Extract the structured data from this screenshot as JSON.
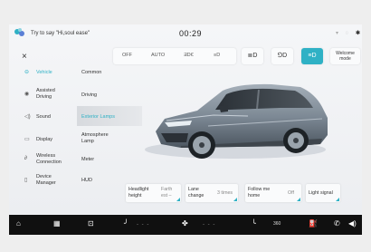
{
  "statusbar": {
    "assistant_hint": "Try to say \"Hi,soul ease\"",
    "time": "00:29",
    "wifi_icon": "wifi-icon",
    "signal_icon": "signal-icon",
    "bluetooth_icon": "bluetooth-icon"
  },
  "toolbar": {
    "close": "×",
    "light_modes": [
      "OFF",
      "AUTO",
      "ƎD€",
      "≡D"
    ],
    "extra_controls": [
      "≣D",
      "⅁D",
      "≡D"
    ],
    "active_control_index": 2,
    "welcome_line1": "Welcome",
    "welcome_line2": "mode"
  },
  "sidebar": {
    "items": [
      {
        "label": "Vehicle",
        "icon": "car-icon",
        "active": true
      },
      {
        "label1": "Assisted",
        "label2": "Driving",
        "icon": "steering-wheel-icon"
      },
      {
        "label": "Sound",
        "icon": "speaker-icon"
      },
      {
        "label": "Display",
        "icon": "monitor-icon"
      },
      {
        "label1": "Wireless",
        "label2": "Connection",
        "icon": "link-icon"
      },
      {
        "label1": "Device",
        "label2": "Manager",
        "icon": "phone-icon"
      }
    ]
  },
  "submenu": {
    "items": [
      {
        "label": "Common"
      },
      {
        "label": "Driving"
      },
      {
        "label": "Exterior Lamps",
        "active": true
      },
      {
        "label1": "Atmosphere",
        "label2": "Lamp"
      },
      {
        "label": "Meter"
      },
      {
        "label": "HUD"
      }
    ]
  },
  "settings": {
    "headlight": {
      "label1": "Headlight",
      "label2": "height",
      "value1": "Farth",
      "value2": "est –"
    },
    "lane_change": {
      "label1": "Lane",
      "label2": "change",
      "value": "3 times"
    },
    "follow_me_home": {
      "label1": "Follow me",
      "label2": "home",
      "value": "Off"
    },
    "light_signal": {
      "label": "Light signal"
    }
  },
  "dock": {
    "items": [
      "home-icon",
      "apps-icon",
      "car-icon",
      "seat-icon",
      "fan-icon",
      "phone-icon",
      "camera-360-icon",
      "fuel-icon",
      "call-icon",
      "volume-icon"
    ],
    "view360_label": "360",
    "dashes": "- - -"
  },
  "colors": {
    "accent": "#2fb1c5",
    "dock": "#101010",
    "car_body": "#7e8a96"
  }
}
